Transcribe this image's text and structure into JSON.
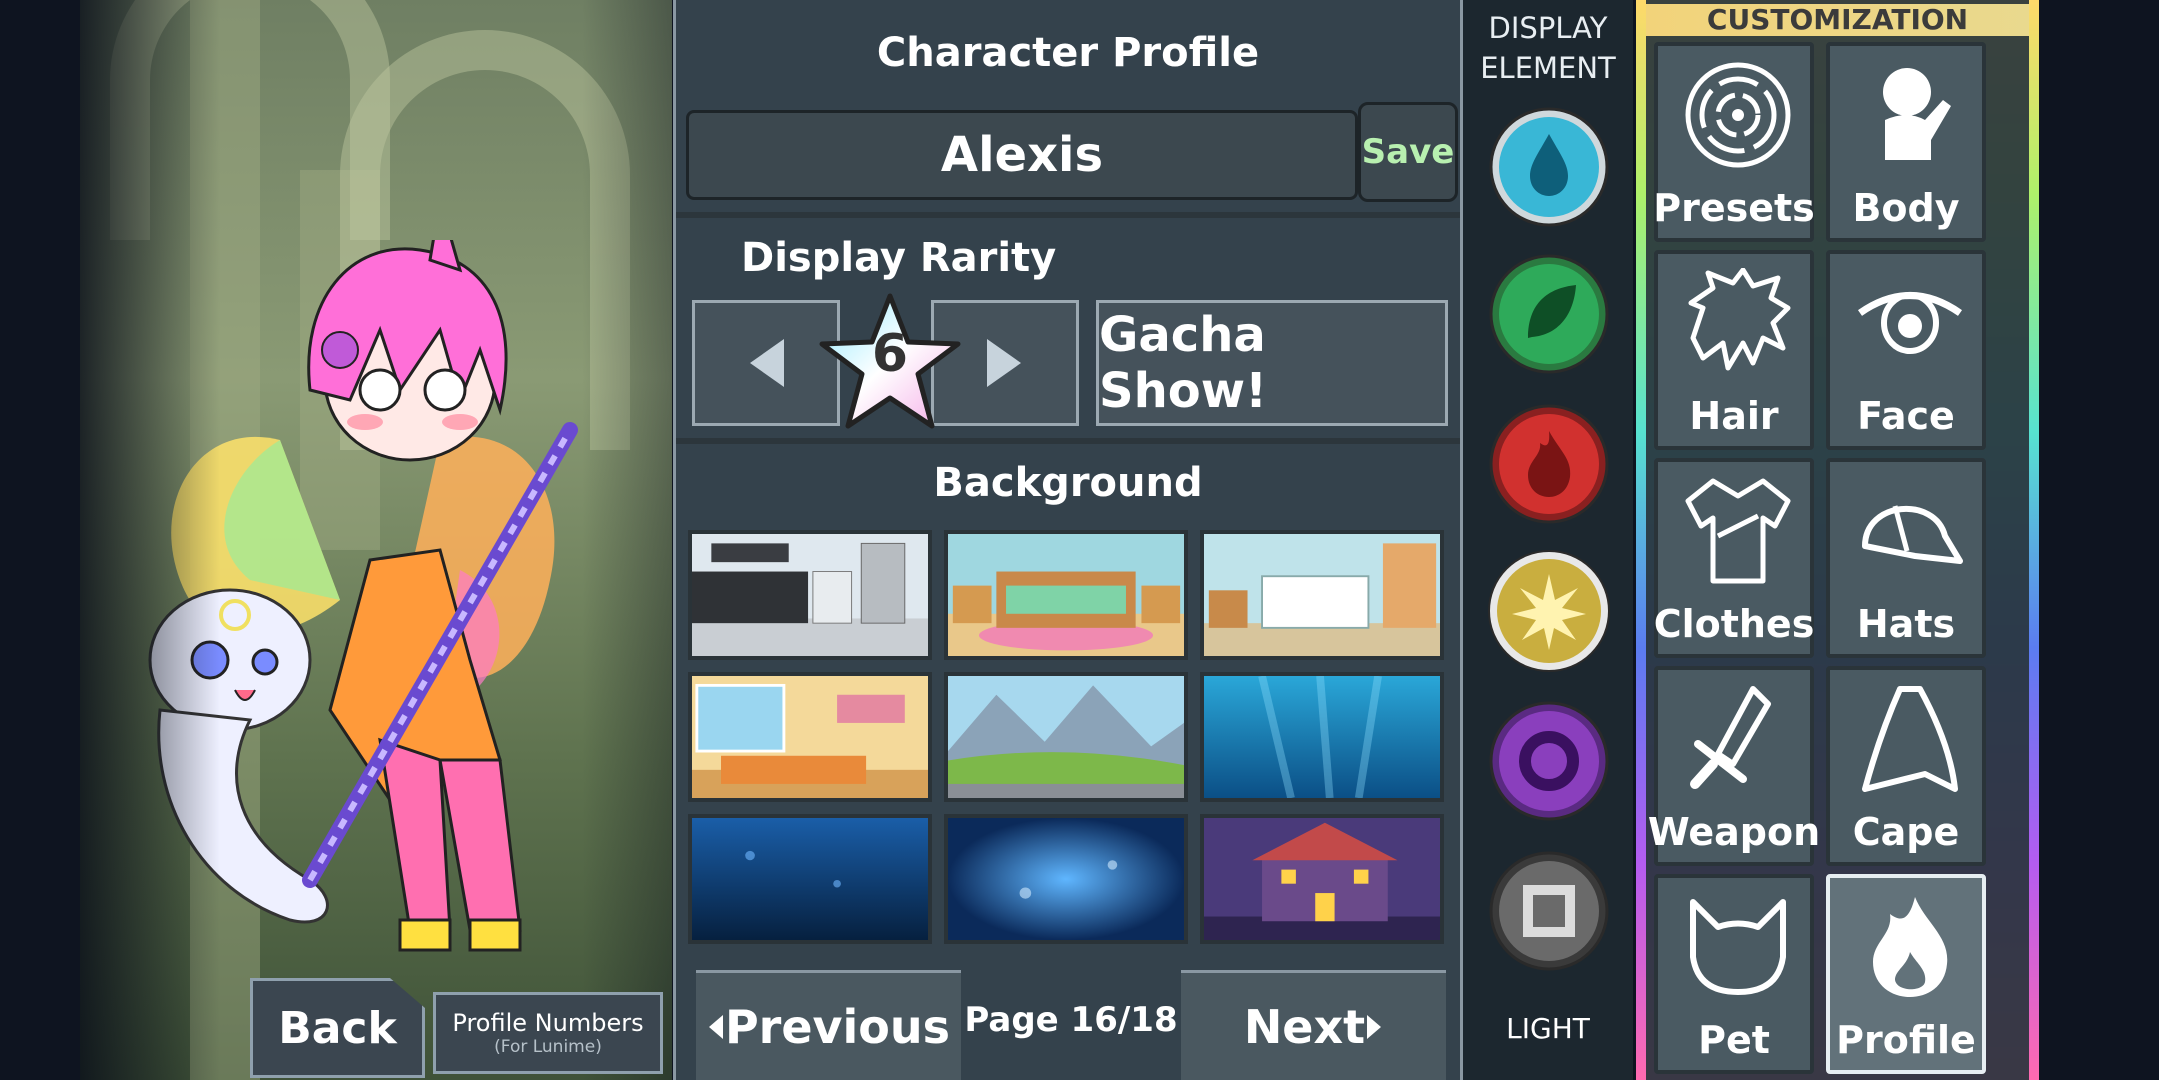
{
  "preview": {
    "back_label": "Back",
    "profile_numbers_label": "Profile Numbers",
    "profile_numbers_sub": "(For Lunime)"
  },
  "profile": {
    "title": "Character Profile",
    "name_value": "Alexis",
    "save_label": "Save",
    "rarity_label": "Display Rarity",
    "rarity_value": "6",
    "gacha_show_label": "Gacha Show!",
    "background_title": "Background",
    "prev_label": "Previous",
    "next_label": "Next",
    "page_indicator": "Page 16/18",
    "backgrounds": [
      "kitchen",
      "bedroom",
      "nursery",
      "living-room",
      "mountains",
      "underwater",
      "deep-sea",
      "night-blue",
      "haunted-house"
    ]
  },
  "elements": {
    "title": "DISPLAY ELEMENT",
    "selected_label": "LIGHT",
    "items": [
      {
        "name": "water",
        "color": "#39b7d6"
      },
      {
        "name": "nature",
        "color": "#2eaa5a"
      },
      {
        "name": "fire",
        "color": "#d1312f"
      },
      {
        "name": "light",
        "color": "#c9ae3f"
      },
      {
        "name": "dark",
        "color": "#8a3fbd"
      },
      {
        "name": "neutral",
        "color": "#6a6a6a"
      }
    ]
  },
  "customization": {
    "title": "CUSTOMIZATION",
    "tiles": [
      {
        "label": "Presets",
        "icon": "presets-icon"
      },
      {
        "label": "Body",
        "icon": "body-icon"
      },
      {
        "label": "Hair",
        "icon": "hair-icon"
      },
      {
        "label": "Face",
        "icon": "face-icon"
      },
      {
        "label": "Clothes",
        "icon": "clothes-icon"
      },
      {
        "label": "Hats",
        "icon": "hat-icon"
      },
      {
        "label": "Weapon",
        "icon": "weapon-icon"
      },
      {
        "label": "Cape",
        "icon": "cape-icon"
      },
      {
        "label": "Pet",
        "icon": "pet-icon"
      },
      {
        "label": "Profile",
        "icon": "flame-icon"
      }
    ]
  },
  "colors": {
    "panel": "#374650",
    "save_text": "#b8f0b0",
    "hair": "#ff6fd8"
  }
}
